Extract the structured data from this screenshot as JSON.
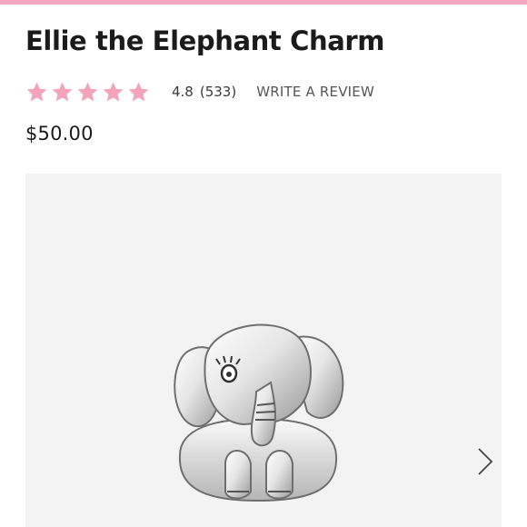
{
  "colors": {
    "accent_pink": "#f4a6be",
    "star_pink": "#f3a4bb",
    "gallery_bg": "#f3f3f3"
  },
  "product": {
    "title": "Ellie the Elephant Charm",
    "price": "$50.00"
  },
  "rating": {
    "value": "4.8",
    "count": "(533)",
    "stars": 5,
    "write_review_label": "WRITE A REVIEW"
  },
  "gallery": {
    "image_icon": "elephant-charm-image",
    "next_icon": "chevron-right-icon"
  }
}
